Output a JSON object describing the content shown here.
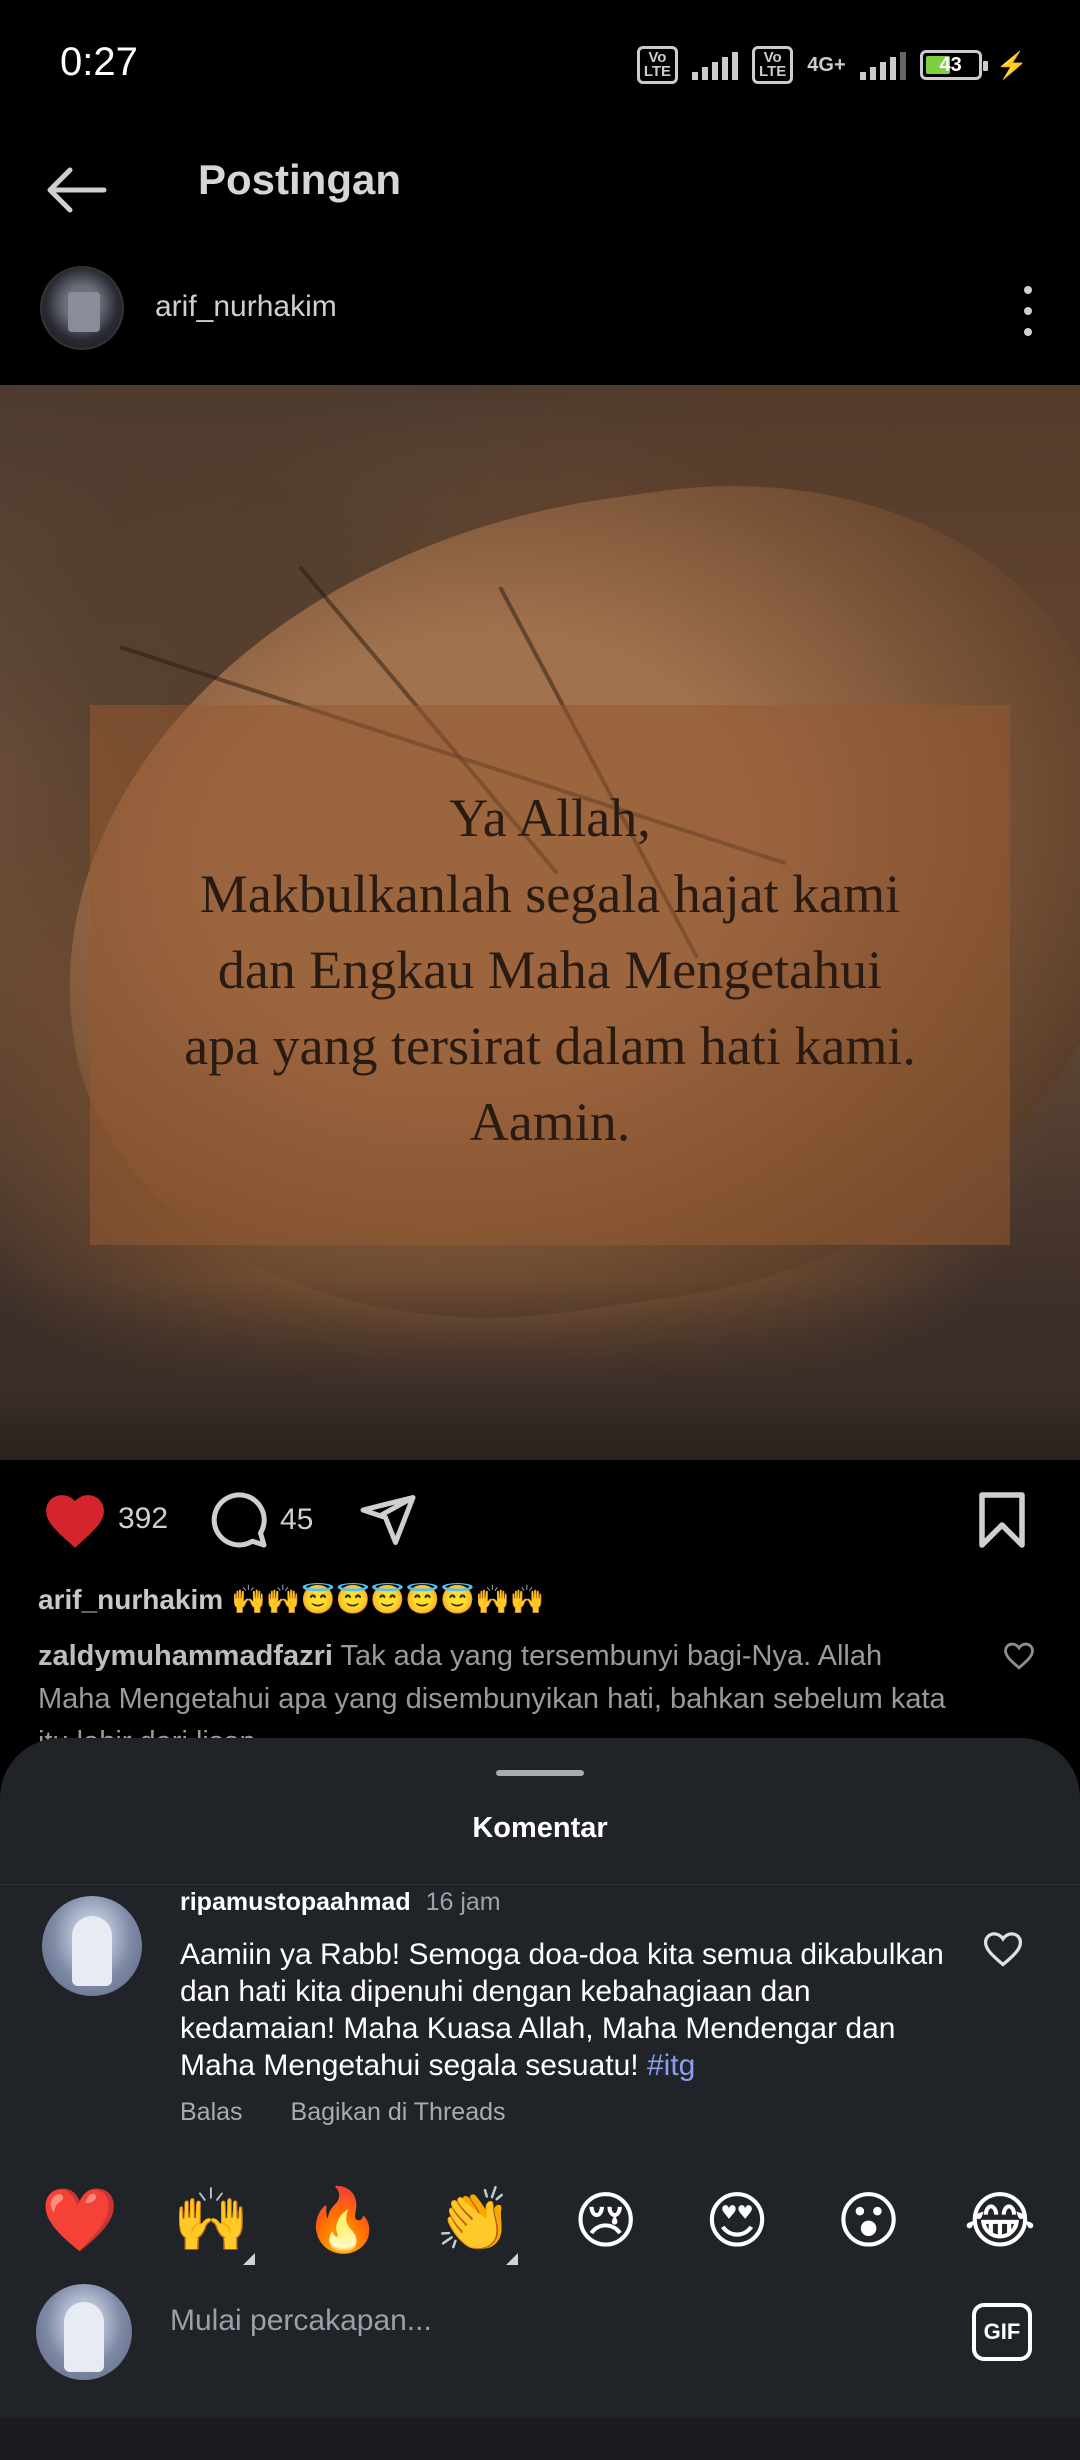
{
  "status_bar": {
    "time": "0:27",
    "volte1": "Vo LTE",
    "volte2": "Vo LTE",
    "network": "4G+",
    "battery": "43",
    "battery_color": "#7bd23c"
  },
  "header": {
    "title": "Postingan",
    "back_icon": "arrow-left-icon"
  },
  "post": {
    "author": "arif_nurhakim",
    "image_text": [
      "Ya Allah,",
      "Makbulkanlah segala hajat kami",
      "dan Engkau Maha Mengetahui",
      "apa yang tersirat dalam hati kami.",
      "Aamin."
    ],
    "likes": "392",
    "comments": "45",
    "like_color": "#d4252f",
    "caption_user": "arif_nurhakim",
    "caption_text": "🙌🙌😇😇😇😇😇🙌🙌",
    "top_comment_user": "zaldymuhammadfazri",
    "top_comment_text": "Tak ada yang tersembunyi bagi-Nya. Allah Maha Mengetahui apa yang disembunyikan hati, bahkan sebelum kata itu lahir dari lisan."
  },
  "comments_sheet": {
    "title": "Komentar",
    "comment": {
      "user": "ripamustopaahmad",
      "time": "16 jam",
      "text": "Aamiin ya Rabb!  Semoga doa-doa kita semua dikabulkan dan hati kita dipenuhi dengan kebahagiaan dan kedamaian!  Maha Kuasa Allah, Maha Mendengar dan Maha Mengetahui segala sesuatu! ",
      "hashtag": "#itg",
      "reply_label": "Balas",
      "share_label": "Bagikan di Threads"
    },
    "emojis": [
      "❤️",
      "🙌",
      "🔥",
      "👏",
      "😢",
      "😍",
      "😮",
      "😂"
    ],
    "composer_placeholder": "Mulai percakapan...",
    "gif_label": "GIF"
  }
}
